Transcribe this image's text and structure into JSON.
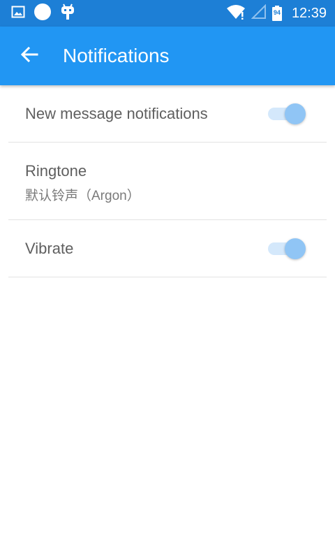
{
  "status_bar": {
    "time": "12:39",
    "battery_level": "94",
    "icons": [
      "image-icon",
      "circle-icon",
      "android-robot-icon",
      "wifi-icon",
      "signal-icon",
      "battery-icon"
    ]
  },
  "app_bar": {
    "back_icon": "arrow-back-icon",
    "title": "Notifications"
  },
  "settings": {
    "items": [
      {
        "title": "New message notifications",
        "toggle_on": true
      },
      {
        "title": "Ringtone",
        "subtitle": "默认铃声（Argon）"
      },
      {
        "title": "Vibrate",
        "toggle_on": true
      }
    ]
  },
  "colors": {
    "status_bar": "#1d7fd6",
    "app_bar": "#2196f3",
    "toggle_thumb": "#90c5f5",
    "toggle_track": "#d4e8fb",
    "text_primary": "#5f5f5f",
    "text_secondary": "#7a7a7a",
    "divider": "#e3e3e3"
  }
}
